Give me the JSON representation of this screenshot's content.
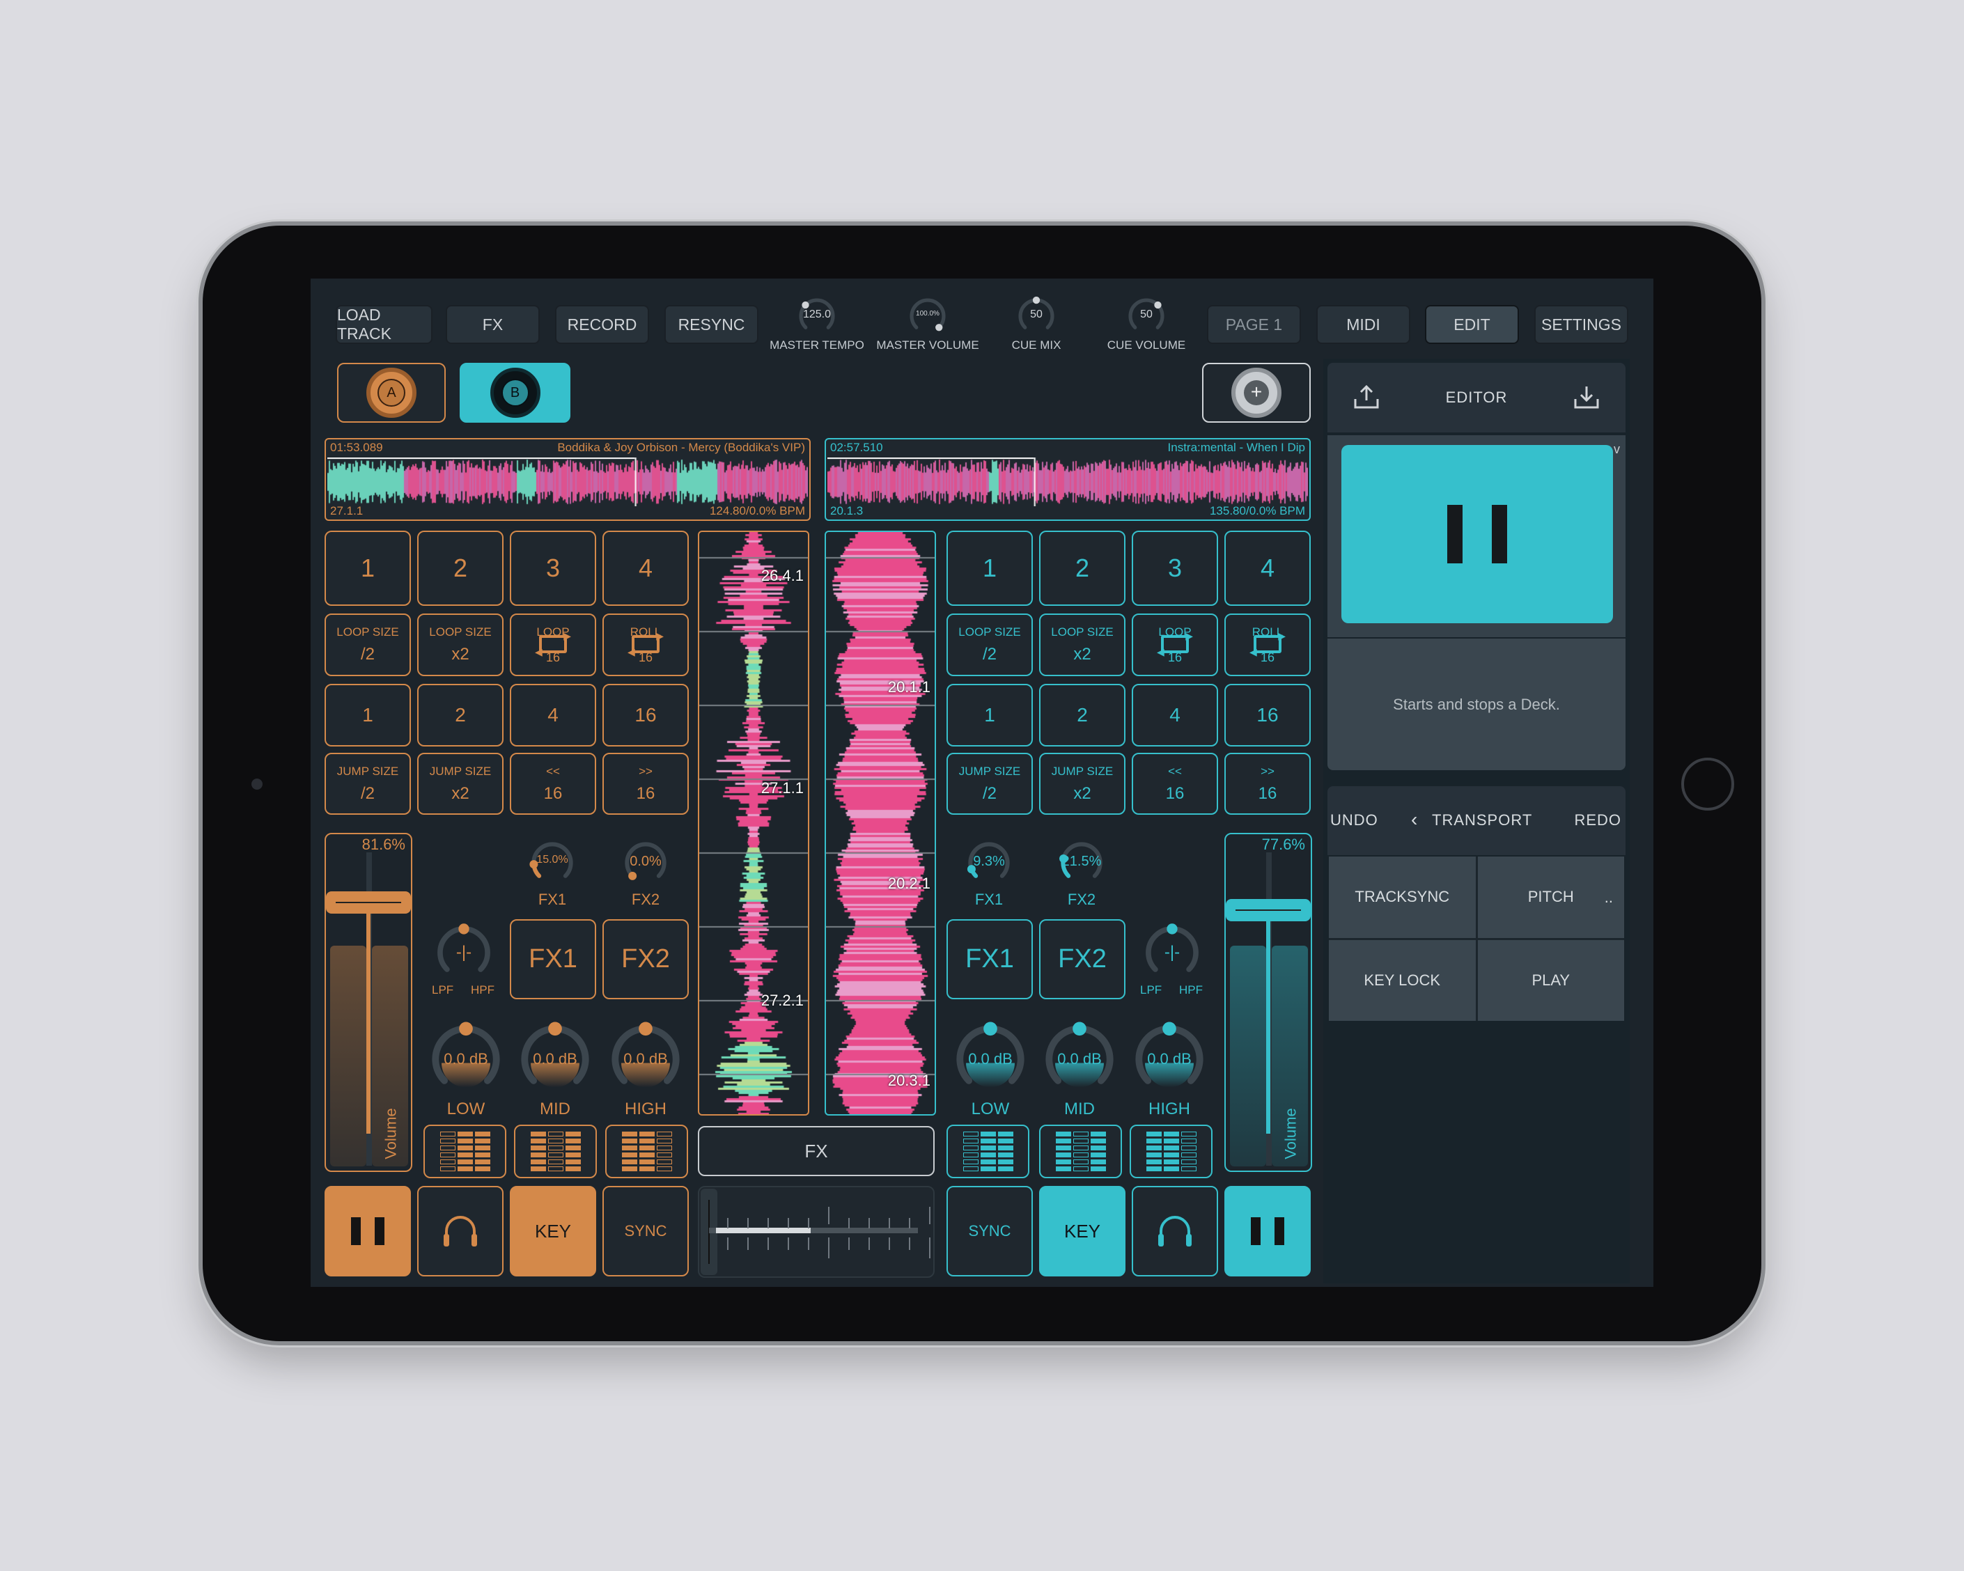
{
  "colors": {
    "deck_a": "#d4894a",
    "deck_b": "#36c0cc",
    "background": "#1c242b",
    "neutral": "#d0d4d8"
  },
  "top_bar": {
    "left_buttons": [
      "LOAD TRACK",
      "FX",
      "RECORD",
      "RESYNC"
    ],
    "knobs": [
      {
        "label": "MASTER TEMPO",
        "value": "125.0",
        "position": 0.33
      },
      {
        "label": "MASTER VOLUME",
        "value": "100.0%",
        "position": 1.0
      },
      {
        "label": "CUE MIX",
        "value": "50",
        "position": 0.5
      },
      {
        "label": "CUE VOLUME",
        "value": "50",
        "position": 0.67
      }
    ],
    "right_buttons": [
      "PAGE 1",
      "MIDI",
      "EDIT",
      "SETTINGS"
    ],
    "active_button": "EDIT"
  },
  "deck_selector": {
    "a": "A",
    "b": "B",
    "selected": "B",
    "add_icon": "plus-icon"
  },
  "editor": {
    "title": "EDITOR",
    "export_icon": "upload-icon",
    "import_icon": "download-icon",
    "preview_icon": "pause-icon",
    "corner_mark": "v",
    "description": "Starts and stops a Deck.",
    "transport": {
      "undo": "UNDO",
      "redo": "REDO",
      "back_icon": "chevron-left-icon",
      "title": "TRANSPORT",
      "items": [
        "TRACKSYNC",
        "PITCH",
        "KEY LOCK",
        "PLAY"
      ],
      "more": ".."
    }
  },
  "deck_a": {
    "overview": {
      "time": "01:53.089",
      "title": "Boddika & Joy Orbison - Mercy (Boddika's VIP)",
      "beat": "27.1.1",
      "bpm": "124.80/0.0% BPM",
      "progress": 0.64
    },
    "markers": [
      "26.4.1",
      "27.1.1",
      "27.2.1"
    ],
    "hotcues": [
      "1",
      "2",
      "3",
      "4"
    ],
    "loop_row": [
      {
        "top": "LOOP SIZE",
        "bottom": "/2"
      },
      {
        "top": "LOOP SIZE",
        "bottom": "x2"
      },
      {
        "top": "LOOP",
        "bottom": "16",
        "icon": "loop-icon"
      },
      {
        "top": "ROLL",
        "bottom": "16",
        "icon": "loop-icon"
      }
    ],
    "lengths": [
      "1",
      "2",
      "4",
      "16"
    ],
    "jump_row": [
      {
        "top": "JUMP SIZE",
        "bottom": "/2"
      },
      {
        "top": "JUMP SIZE",
        "bottom": "x2"
      },
      {
        "top": "<<",
        "bottom": "16"
      },
      {
        "top": ">>",
        "bottom": "16"
      }
    ],
    "volume": {
      "value": "81.6%",
      "level": 0.816,
      "label": "Volume"
    },
    "fx_knobs": [
      {
        "value": "15.0%",
        "level": 0.15,
        "label": "FX1"
      },
      {
        "value": "0.0%",
        "level": 0.0,
        "label": "FX2"
      }
    ],
    "filter": {
      "value": "-|-",
      "level": 0.5,
      "lpf": "LPF",
      "hpf": "HPF"
    },
    "fx_buttons": [
      "FX1",
      "FX2"
    ],
    "eq": [
      {
        "value": "0.0 dB",
        "label": "LOW",
        "level": 0.5
      },
      {
        "value": "0.0 dB",
        "label": "MID",
        "level": 0.5
      },
      {
        "value": "0.0 dB",
        "label": "HIGH",
        "level": 0.5
      }
    ],
    "bottom": {
      "play_icon": "pause-icon",
      "cue_icon": "headphones-icon",
      "key": "KEY",
      "sync": "SYNC",
      "key_active": true
    }
  },
  "deck_b": {
    "overview": {
      "time": "02:57.510",
      "title": "Instra:mental - When I Dip",
      "beat": "20.1.3",
      "bpm": "135.80/0.0% BPM",
      "progress": 0.43
    },
    "markers": [
      "20.1.1",
      "20.2.1",
      "20.3.1"
    ],
    "hotcues": [
      "1",
      "2",
      "3",
      "4"
    ],
    "loop_row": [
      {
        "top": "LOOP SIZE",
        "bottom": "/2"
      },
      {
        "top": "LOOP SIZE",
        "bottom": "x2"
      },
      {
        "top": "LOOP",
        "bottom": "16",
        "icon": "loop-icon"
      },
      {
        "top": "ROLL",
        "bottom": "16",
        "icon": "loop-icon"
      }
    ],
    "lengths": [
      "1",
      "2",
      "4",
      "16"
    ],
    "jump_row": [
      {
        "top": "JUMP SIZE",
        "bottom": "/2"
      },
      {
        "top": "JUMP SIZE",
        "bottom": "x2"
      },
      {
        "top": "<<",
        "bottom": "16"
      },
      {
        "top": ">>",
        "bottom": "16"
      }
    ],
    "volume": {
      "value": "77.6%",
      "level": 0.776,
      "label": "Volume"
    },
    "fx_knobs": [
      {
        "value": "9.3%",
        "level": 0.093,
        "label": "FX1"
      },
      {
        "value": "21.5%",
        "level": 0.215,
        "label": "FX2"
      }
    ],
    "filter": {
      "value": "-|-",
      "level": 0.5,
      "lpf": "LPF",
      "hpf": "HPF"
    },
    "fx_buttons": [
      "FX1",
      "FX2"
    ],
    "eq": [
      {
        "value": "0.0 dB",
        "label": "LOW",
        "level": 0.5
      },
      {
        "value": "0.0 dB",
        "label": "MID",
        "level": 0.5
      },
      {
        "value": "0.0 dB",
        "label": "HIGH",
        "level": 0.5
      }
    ],
    "bottom": {
      "play_icon": "pause-icon",
      "cue_icon": "headphones-icon",
      "key": "KEY",
      "sync": "SYNC",
      "key_active": true
    }
  },
  "center": {
    "fx_label": "FX",
    "crossfader": 0.0
  }
}
